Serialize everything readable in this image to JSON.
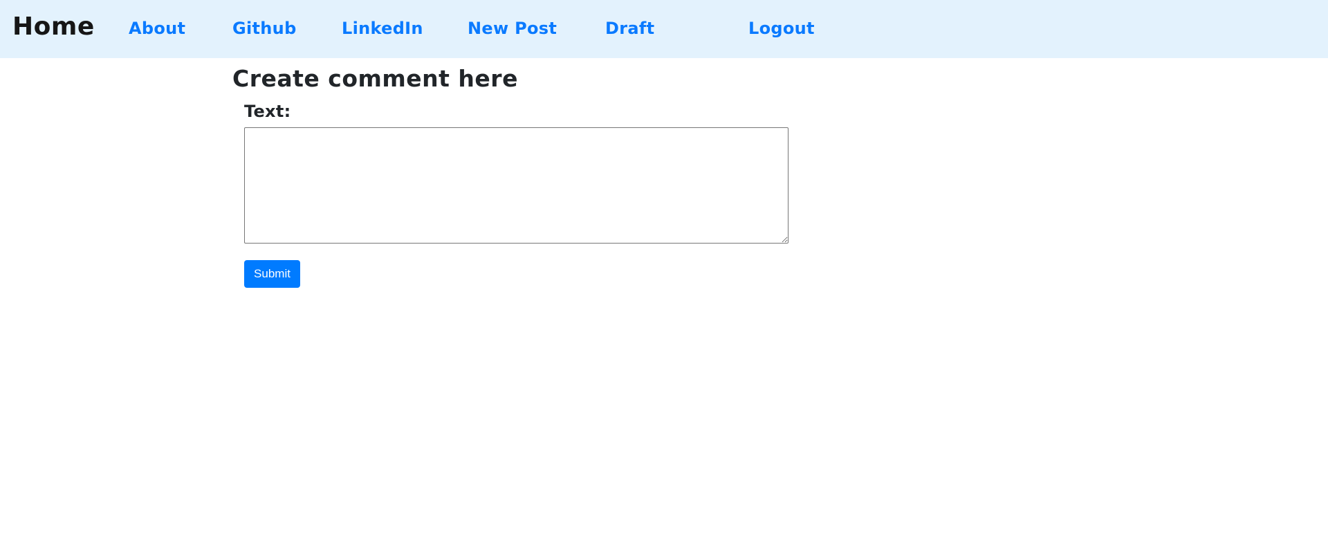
{
  "navbar": {
    "brand": "Home",
    "links": [
      {
        "label": "About"
      },
      {
        "label": "Github"
      },
      {
        "label": "LinkedIn"
      },
      {
        "label": "New Post"
      },
      {
        "label": "Draft"
      },
      {
        "label": "Logout"
      }
    ]
  },
  "form": {
    "title": "Create comment here",
    "text_label": "Text:",
    "text_value": "",
    "submit_label": "Submit"
  },
  "colors": {
    "navbar_bg": "#e3f2fd",
    "link": "#0a7aff",
    "button_bg": "#007bff"
  }
}
